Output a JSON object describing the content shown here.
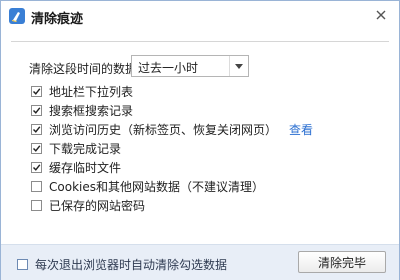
{
  "window": {
    "title": "清除痕迹",
    "close_icon": "close-x"
  },
  "time_range": {
    "label": "清除这段时间的数据：",
    "selected": "过去一小时"
  },
  "options": [
    {
      "label": "地址栏下拉列表",
      "checked": true
    },
    {
      "label": "搜索框搜索记录",
      "checked": true
    },
    {
      "label": "浏览访问历史（新标签页、恢复关闭网页）",
      "checked": true,
      "link": "查看"
    },
    {
      "label": "下载完成记录",
      "checked": true
    },
    {
      "label": "缓存临时文件",
      "checked": true
    },
    {
      "label": "Cookies和其他网站数据（不建议清理）",
      "checked": false
    },
    {
      "label": "已保存的网站密码",
      "checked": false
    }
  ],
  "footer": {
    "auto_clear_label": "每次退出浏览器时自动清除勾选数据",
    "auto_clear_checked": false,
    "done_label": "清除完毕"
  },
  "colors": {
    "accent": "#3a7fd5",
    "link": "#2b6fd1",
    "footer_bg": "#e8eef7"
  }
}
